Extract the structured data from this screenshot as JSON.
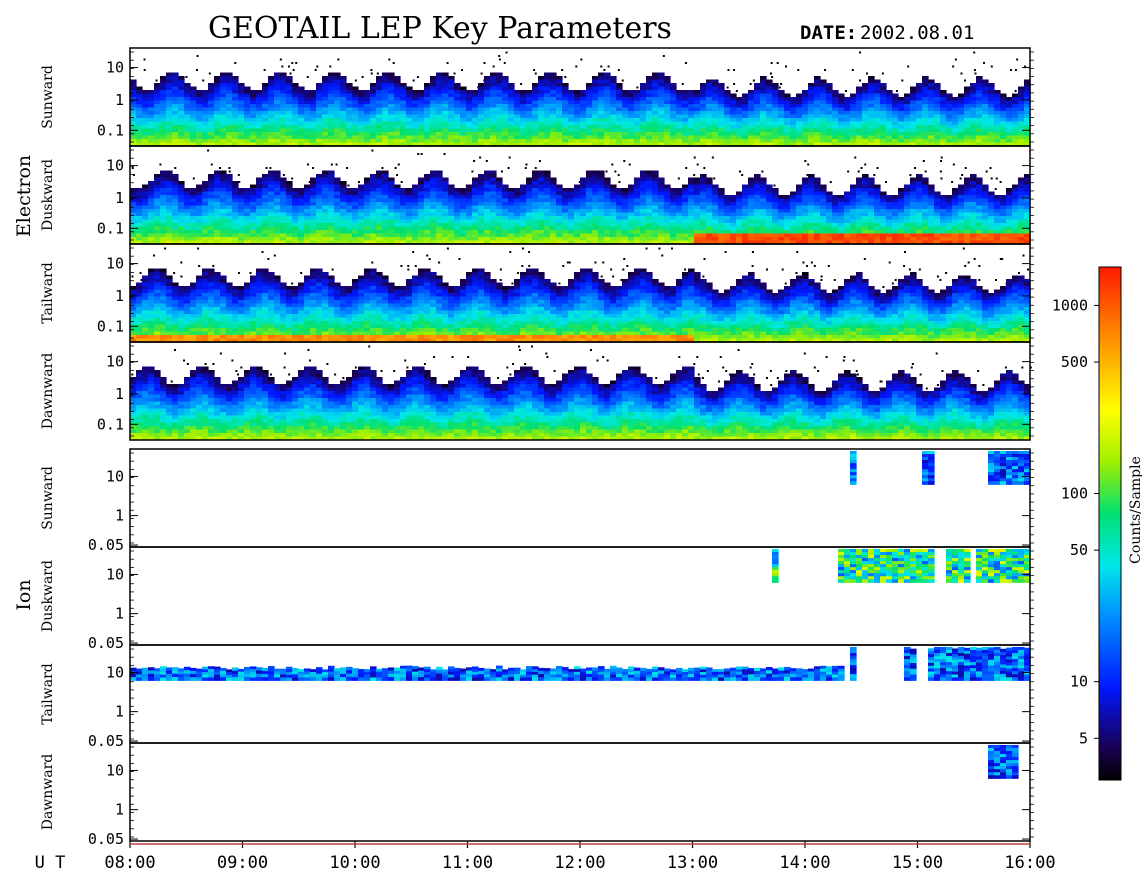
{
  "header": {
    "title": "GEOTAIL LEP Key Parameters",
    "date_label": "DATE:",
    "date_value": "2002.08.01"
  },
  "chart_data": {
    "type": "heatmap",
    "instrument": "GEOTAIL LEP",
    "x_axis": {
      "label": "U T",
      "range": [
        "08:00",
        "16:00"
      ],
      "ticks": [
        "08:00",
        "09:00",
        "10:00",
        "11:00",
        "12:00",
        "13:00",
        "14:00",
        "15:00",
        "16:00"
      ]
    },
    "groups": [
      {
        "name": "Electron",
        "panels": [
          {
            "name": "Sunward",
            "y_ticks": [
              "10",
              "1",
              "0.1"
            ],
            "ylim": [
              0.04,
              30
            ],
            "scale": "log"
          },
          {
            "name": "Duskward",
            "y_ticks": [
              "10",
              "1",
              "0.1"
            ],
            "ylim": [
              0.04,
              30
            ],
            "scale": "log"
          },
          {
            "name": "Tailward",
            "y_ticks": [
              "10",
              "1",
              "0.1"
            ],
            "ylim": [
              0.04,
              30
            ],
            "scale": "log"
          },
          {
            "name": "Dawnward",
            "y_ticks": [
              "10",
              "1",
              "0.1"
            ],
            "ylim": [
              0.04,
              30
            ],
            "scale": "log"
          }
        ]
      },
      {
        "name": "Ion",
        "panels": [
          {
            "name": "Sunward",
            "y_ticks": [
              "10",
              "1",
              "0.05"
            ],
            "ylim": [
              0.04,
              30
            ],
            "scale": "log"
          },
          {
            "name": "Duskward",
            "y_ticks": [
              "10",
              "1",
              "0.05"
            ],
            "ylim": [
              0.04,
              30
            ],
            "scale": "log"
          },
          {
            "name": "Tailward",
            "y_ticks": [
              "10",
              "1",
              "0.05"
            ],
            "ylim": [
              0.04,
              30
            ],
            "scale": "log"
          },
          {
            "name": "Dawnward",
            "y_ticks": [
              "10",
              "1",
              "0.05"
            ],
            "ylim": [
              0.04,
              30
            ],
            "scale": "log"
          }
        ]
      }
    ],
    "colorbar": {
      "label": "Counts/Sample",
      "scale": "log",
      "range": [
        3,
        1600
      ],
      "ticks": [
        "1000",
        "500",
        "100",
        "50",
        "10",
        "5"
      ],
      "tick_values": [
        1000,
        500,
        100,
        50,
        10,
        5
      ],
      "colormap": "rainbow"
    }
  }
}
